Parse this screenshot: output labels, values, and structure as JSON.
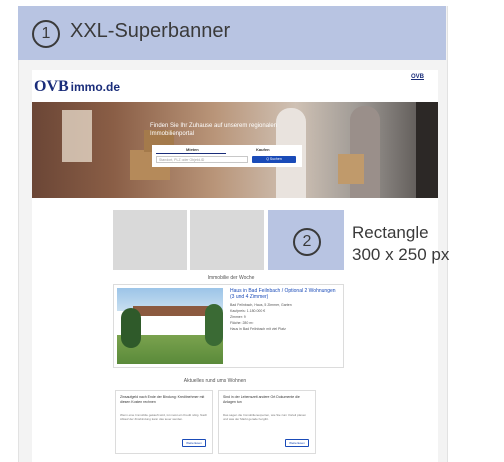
{
  "superbanner": {
    "number": "1",
    "label": "XXL-Superbanner"
  },
  "site": {
    "logo_main": "OVB",
    "logo_rest": "immo.de",
    "top_link": "OVB",
    "hero_title": "Finden Sie Ihr Zuhause auf unserem regionalen Immobilienportal",
    "search": {
      "tab_mieten": "Mieten",
      "tab_kaufen": "Kaufen",
      "placeholder": "Standort, PLZ oder Objekt-ID",
      "button": "Q Suchen"
    }
  },
  "rectangle": {
    "number": "2",
    "label_line1": "Rectangle",
    "label_line2": "300 x 250 px"
  },
  "week": {
    "title": "Immobilie der Woche",
    "card_title": "Haus in Bad Feilnbach / Optional 2 Wohnungen (3 und 4 Zimmer)",
    "lines": [
      "Bad Feilnbach, Haus, 5 Zimmer, Garten",
      "Kaufpreis: 1.180.000 €",
      "Zimmer: 9",
      "Fläche: 280 m²",
      "Haus in Bad Feilnbach mit viel Platz"
    ]
  },
  "news": {
    "title": "Aktuelles rund ums Wohnen",
    "items": [
      {
        "head": "Zinsaufgeld nach Ende der Bindung: Kreditnehmer mit diesen Kosten rechnen",
        "body": "Wenn eine Immobilie gekauft wird, ist meist ein Kredit nötig. Nach Ablauf der Zinsbindung kann das teuer werden.",
        "button": "Weiterlesen"
      },
      {
        "head": "Sind in der Lebenszeit andere Ort Dokumente die Anlagen tun",
        "body": "Das sagen die Immobilienexperten, wie Sie zum Vorteil planen und was der Markt gerade hergibt.",
        "button": "Weiterlesen"
      }
    ]
  }
}
